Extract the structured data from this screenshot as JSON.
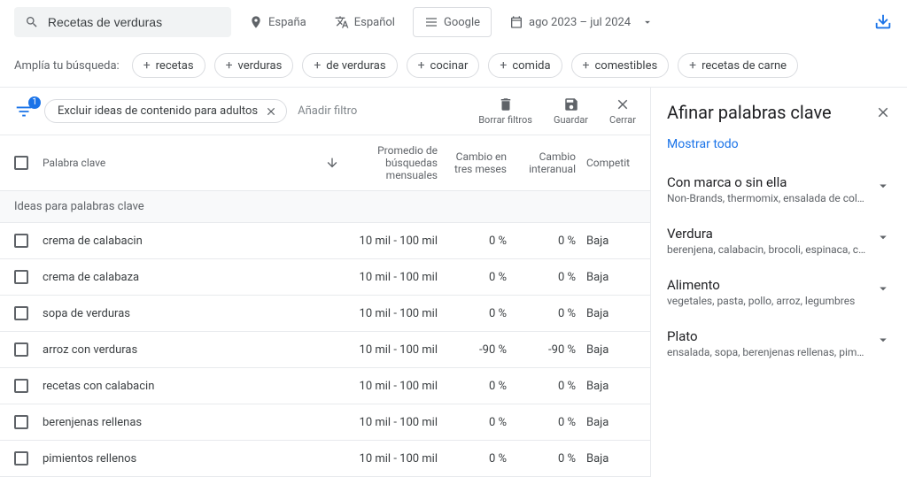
{
  "top": {
    "search_value": "Recetas de verduras",
    "location": "España",
    "language": "Español",
    "network": "Google",
    "date_range": "ago 2023 – jul 2024"
  },
  "broaden": {
    "label": "Amplía tu búsqueda:",
    "items": [
      "recetas",
      "verduras",
      "de verduras",
      "cocinar",
      "comida",
      "comestibles",
      "recetas de carne"
    ]
  },
  "filters": {
    "badge": "1",
    "active": "Excluir ideas de contenido para adultos",
    "add_label": "Añadir filtro",
    "actions": {
      "clear": "Borrar filtros",
      "save": "Guardar",
      "close": "Cerrar"
    }
  },
  "table": {
    "headers": {
      "keyword": "Palabra clave",
      "searches": "Promedio de búsquedas mensuales",
      "three_month": "Cambio en tres meses",
      "yoy": "Cambio interanual",
      "competition": "Competit"
    },
    "section_label": "Ideas para palabras clave",
    "rows": [
      {
        "keyword": "crema de calabacin",
        "searches": "10 mil - 100 mil",
        "three_month": "0 %",
        "yoy": "0 %",
        "comp": "Baja"
      },
      {
        "keyword": "crema de calabaza",
        "searches": "10 mil - 100 mil",
        "three_month": "0 %",
        "yoy": "0 %",
        "comp": "Baja"
      },
      {
        "keyword": "sopa de verduras",
        "searches": "10 mil - 100 mil",
        "three_month": "0 %",
        "yoy": "0 %",
        "comp": "Baja"
      },
      {
        "keyword": "arroz con verduras",
        "searches": "10 mil - 100 mil",
        "three_month": "-90 %",
        "yoy": "-90 %",
        "comp": "Baja"
      },
      {
        "keyword": "recetas con calabacin",
        "searches": "10 mil - 100 mil",
        "three_month": "0 %",
        "yoy": "0 %",
        "comp": "Baja"
      },
      {
        "keyword": "berenjenas rellenas",
        "searches": "10 mil - 100 mil",
        "three_month": "0 %",
        "yoy": "0 %",
        "comp": "Baja"
      },
      {
        "keyword": "pimientos rellenos",
        "searches": "10 mil - 100 mil",
        "three_month": "0 %",
        "yoy": "0 %",
        "comp": "Baja"
      }
    ]
  },
  "refine": {
    "title": "Afinar palabras clave",
    "show_all": "Mostrar todo",
    "groups": [
      {
        "title": "Con marca o sin ella",
        "sub": "Non-Brands, thermomix, ensalada de col, me..."
      },
      {
        "title": "Verdura",
        "sub": "berenjena, calabacin, brocoli, espinaca, coliflor"
      },
      {
        "title": "Alimento",
        "sub": "vegetales, pasta, pollo, arroz, legumbres"
      },
      {
        "title": "Plato",
        "sub": "ensalada, sopa, berenjenas rellenas, pimient..."
      }
    ]
  }
}
